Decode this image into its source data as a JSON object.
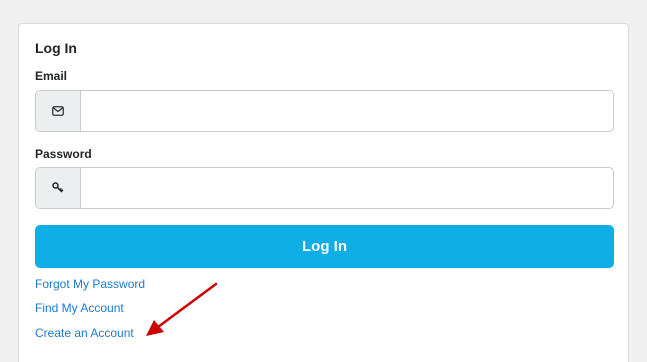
{
  "form": {
    "title": "Log In",
    "email_label": "Email",
    "email_value": "",
    "email_icon": "envelope-icon",
    "password_label": "Password",
    "password_value": "",
    "password_icon": "key-icon",
    "submit_label": "Log In"
  },
  "links": {
    "forgot_password": "Forgot My Password",
    "find_account": "Find My Account",
    "create_account": "Create an Account"
  },
  "annotation": {
    "arrow_icon": "red-arrow-icon",
    "arrow_color": "#cc0000"
  },
  "colors": {
    "accent": "#0eafe6",
    "link": "#1b7bd0",
    "background": "#f0f0f1"
  }
}
